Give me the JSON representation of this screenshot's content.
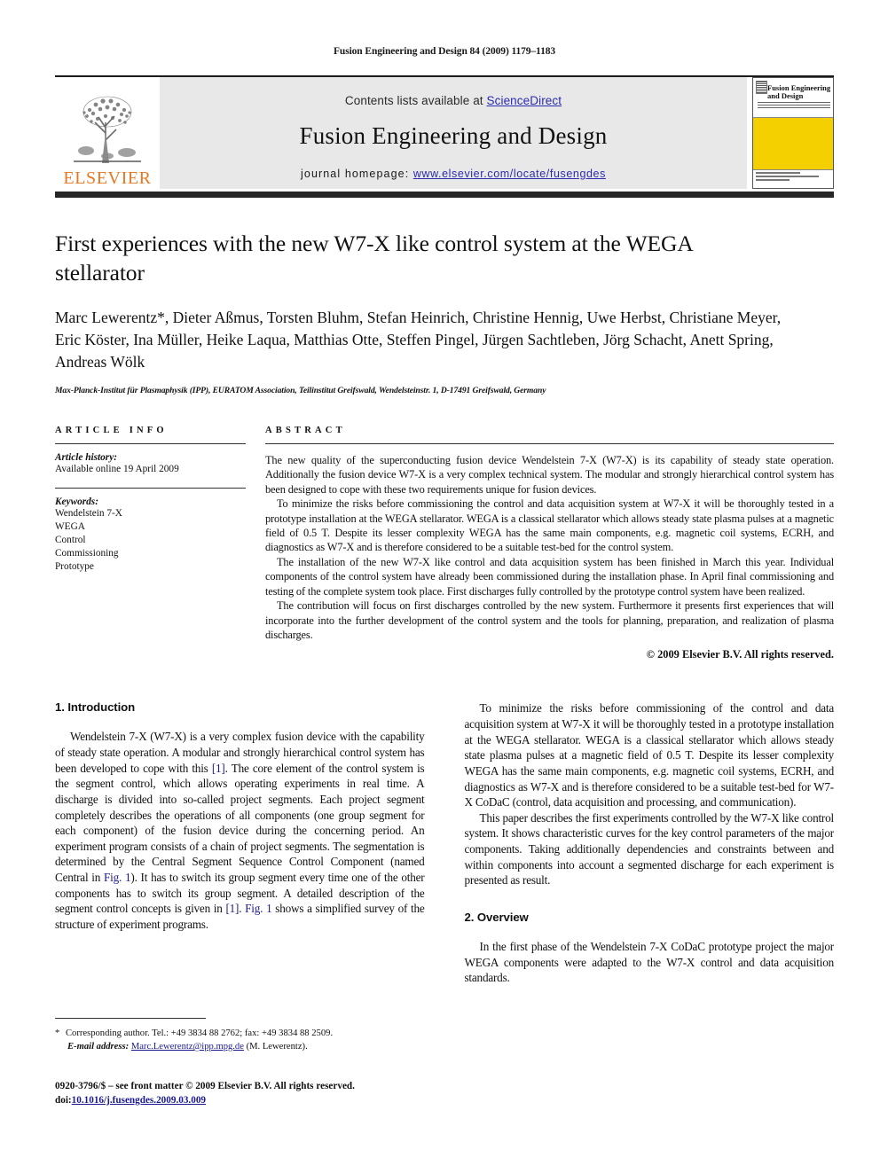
{
  "running_head": "Fusion Engineering and Design 84 (2009) 1179–1183",
  "masthead": {
    "contents_prefix": "Contents lists available at ",
    "sciencedirect": "ScienceDirect",
    "journal_title": "Fusion Engineering and Design",
    "homepage_prefix": "journal homepage: ",
    "homepage_url": "www.elsevier.com/locate/fusengdes",
    "publisher_wordmark": "ELSEVIER",
    "publisher_logo_color": "#E87722",
    "link_color": "#2b2bb0",
    "band_color": "#e8e8e8",
    "cover": {
      "title": "Fusion Engineering and Design",
      "accent_color": "#F5D000"
    }
  },
  "article": {
    "title": "First experiences with the new W7-X like control system at the WEGA stellarator",
    "authors": "Marc Lewerentz*, Dieter Aßmus, Torsten Bluhm, Stefan Heinrich, Christine Hennig, Uwe Herbst, Christiane Meyer, Eric Köster, Ina Müller, Heike Laqua, Matthias Otte, Steffen Pingel, Jürgen Sachtleben, Jörg Schacht, Anett Spring, Andreas Wölk",
    "affiliation": "Max-Planck-Institut für Plasmaphysik (IPP), EURATOM Association, Teilinstitut Greifswald, Wendelsteinstr. 1, D-17491 Greifswald, Germany"
  },
  "info": {
    "heading": "ARTICLE INFO",
    "history_label": "Article history:",
    "history_value": "Available online 19 April 2009",
    "keywords_label": "Keywords:",
    "keywords": [
      "Wendelstein 7-X",
      "WEGA",
      "Control",
      "Commissioning",
      "Prototype"
    ]
  },
  "abstract": {
    "heading": "ABSTRACT",
    "paragraphs": [
      "The new quality of the superconducting fusion device Wendelstein 7-X (W7-X) is its capability of steady state operation. Additionally the fusion device W7-X is a very complex technical system. The modular and strongly hierarchical control system has been designed to cope with these two requirements unique for fusion devices.",
      "To minimize the risks before commissioning the control and data acquisition system at W7-X it will be thoroughly tested in a prototype installation at the WEGA stellarator. WEGA is a classical stellarator which allows steady state plasma pulses at a magnetic field of 0.5 T. Despite its lesser complexity WEGA has the same main components, e.g. magnetic coil systems, ECRH, and diagnostics as W7-X and is therefore considered to be a suitable test-bed for the control system.",
      "The installation of the new W7-X like control and data acquisition system has been finished in March this year. Individual components of the control system have already been commissioned during the installation phase. In April final commissioning and testing of the complete system took place. First discharges fully controlled by the prototype control system have been realized.",
      "The contribution will focus on first discharges controlled by the new system. Furthermore it presents first experiences that will incorporate into the further development of the control system and the tools for planning, preparation, and realization of plasma discharges."
    ],
    "copyright": "© 2009 Elsevier B.V. All rights reserved."
  },
  "body": {
    "left_column": {
      "section_1_heading": "1. Introduction",
      "paragraph_1_a": "Wendelstein 7-X (W7-X) is a very complex fusion device with the capability of steady state operation. A modular and strongly hierarchical control system has been developed to cope with this ",
      "ref_1": "[1]",
      "paragraph_1_b": ". The core element of the control system is the segment control, which allows operating experiments in real time. A discharge is divided into so-called project segments. Each project segment completely describes the operations of all components (one group segment for each component) of the fusion device during the concerning period. An experiment program consists of a chain of project segments. The segmentation is determined by the Central Segment Sequence Control Component (named Central in ",
      "ref_fig1_a": "Fig. 1",
      "paragraph_1_c": "). It has to switch its group segment every time one of the other components has to switch its group segment. A detailed description of the segment control concepts is given in ",
      "ref_1_b": "[1]",
      "paragraph_1_d": ". ",
      "ref_fig1_b": "Fig. 1",
      "paragraph_1_e": " shows a simplified survey of the structure of experiment programs."
    },
    "right_column": {
      "paragraph_1": "To minimize the risks before commissioning of the control and data acquisition system at W7-X it will be thoroughly tested in a prototype installation at the WEGA stellarator. WEGA is a classical stellarator which allows steady state plasma pulses at a magnetic field of 0.5 T. Despite its lesser complexity WEGA has the same main components, e.g. magnetic coil systems, ECRH, and diagnostics as W7-X and is therefore considered to be a suitable test-bed for W7-X CoDaC (control, data acquisition and processing, and communication).",
      "paragraph_2": "This paper describes the first experiments controlled by the W7-X like control system. It shows characteristic curves for the key control parameters of the major components. Taking additionally dependencies and constraints between and within components into account a segmented discharge for each experiment is presented as result.",
      "section_2_heading": "2. Overview",
      "paragraph_3": "In the first phase of the Wendelstein 7-X CoDaC prototype project the major WEGA components were adapted to the W7-X control and data acquisition standards."
    }
  },
  "footnote": {
    "marker": "*",
    "corresponding": "Corresponding author. Tel.: +49 3834 88 2762; fax: +49 3834 88 2509.",
    "email_label": "E-mail address:",
    "email": "Marc.Lewerentz@ipp.mpg.de",
    "email_owner": "(M. Lewerentz)."
  },
  "footer": {
    "issn_line": "0920-3796/$ – see front matter © 2009 Elsevier B.V. All rights reserved.",
    "doi_label": "doi:",
    "doi": "10.1016/j.fusengdes.2009.03.009"
  }
}
